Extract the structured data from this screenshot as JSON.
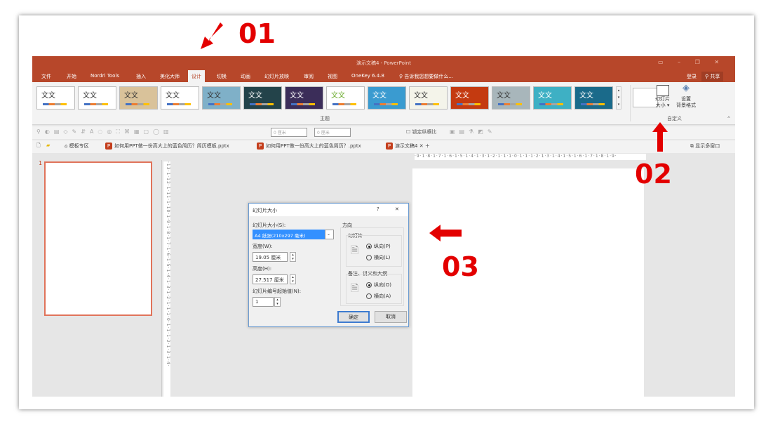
{
  "window": {
    "title": "演示文稿4 - PowerPoint",
    "login": "登录",
    "share": "共享"
  },
  "tabs": [
    "文件",
    "开始",
    "Nordri Tools",
    "插入",
    "美化大师",
    "设计",
    "切换",
    "动画",
    "幻灯片放映",
    "审阅",
    "视图",
    "OneKey 6.4.8"
  ],
  "active_tab": "设计",
  "tell_me": "告诉我您想要做什么...",
  "ribbon": {
    "themes_label": "主题",
    "theme_text": "文文",
    "slide_size": "幻灯片\n大小 ▾",
    "slide_size_l1": "幻灯片",
    "slide_size_l2": "大小 ▾",
    "format_bg_l1": "设置",
    "format_bg_l2": "背景格式",
    "custom_group": "自定义"
  },
  "toolbar2": {
    "w_value": "0 厘米",
    "h_value": "0 厘米",
    "lock_ratio": "锁定纵横比"
  },
  "file_tabs": {
    "template_zone": "模板专区",
    "file1": "如何用PPT做一份高大上的蓝色简历？简历模板.pptx",
    "file2": "如何用PPT做一份高大上的蓝色简历？.pptx",
    "file3": "演示文稿4",
    "multi_window": "显示多窗口"
  },
  "ruler_h": "·9·1·8·1·7·1·6·1·5·1·4·1·3·1·2·1·1·1·0·1·1·1·2·1·3·1·4·1·5·1·6·1·7·1·8·1·9·",
  "ruler_v": "·13·1·12·1·11·1·10·1·9·1·8·1·7·1·6·1·5·1·4·1·3·1·2·1·1·1·0·1·1·1·2·1·3·1·4·",
  "slide_number": "1",
  "dialog": {
    "title": "幻灯片大小",
    "help": "?",
    "close": "✕",
    "size_label": "幻灯片大小(S):",
    "size_value": "A4 纸张(210x297 毫米)",
    "width_label": "宽度(W):",
    "width_value": "19.05 厘米",
    "height_label": "高度(H):",
    "height_value": "27.517 厘米",
    "start_label": "幻灯片编号起始值(N):",
    "start_value": "1",
    "orientation": "方向",
    "slides_group": "幻灯片",
    "portrait": "纵向(P)",
    "landscape": "横向(L)",
    "notes_group": "备注、讲义和大纲",
    "notes_portrait": "纵向(O)",
    "notes_landscape": "横向(A)",
    "ok": "确定",
    "cancel": "取消"
  },
  "annotations": {
    "a1": "01",
    "a2": "02",
    "a3": "03"
  },
  "colors": {
    "accent": "#b7472a",
    "annotation": "#e30000"
  }
}
